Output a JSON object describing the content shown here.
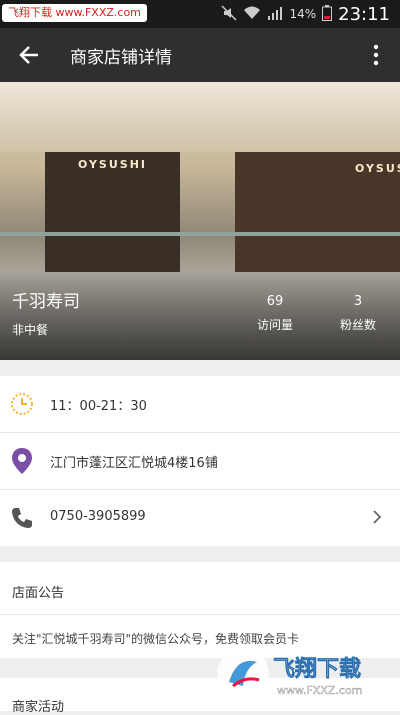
{
  "status_bar": {
    "watermark": "飞翔下载 www.FXXZ.com",
    "battery": "14%",
    "time": "23:11"
  },
  "app_bar": {
    "title": "商家店铺详情"
  },
  "shop": {
    "name": "千羽寿司",
    "category": "非中餐",
    "hero_signs": [
      "OYSUSHI",
      "OYSUSHI"
    ],
    "stats": [
      {
        "value": "69",
        "label": "访问量"
      },
      {
        "value": "3",
        "label": "粉丝数"
      }
    ]
  },
  "info": {
    "hours": "11：00-21：30",
    "address": "江门市蓬江区汇悦城4楼16铺",
    "phone": "0750-3905899"
  },
  "announcement": {
    "title": "店面公告",
    "text": "关注\"汇悦城千羽寿司\"的微信公众号，免费领取会员卡"
  },
  "activities": {
    "title": "商家活动"
  },
  "bottom_watermark": {
    "brand": "飞翔下载",
    "url": "www.FXXZ.com"
  },
  "colors": {
    "app_bar": "#2f2f2f",
    "status_bar": "#1a1a1a",
    "clock_icon": "#f2b233",
    "pin_icon": "#7b4fa6",
    "phone_icon": "#555555",
    "watermark_red": "#d81e1e"
  }
}
